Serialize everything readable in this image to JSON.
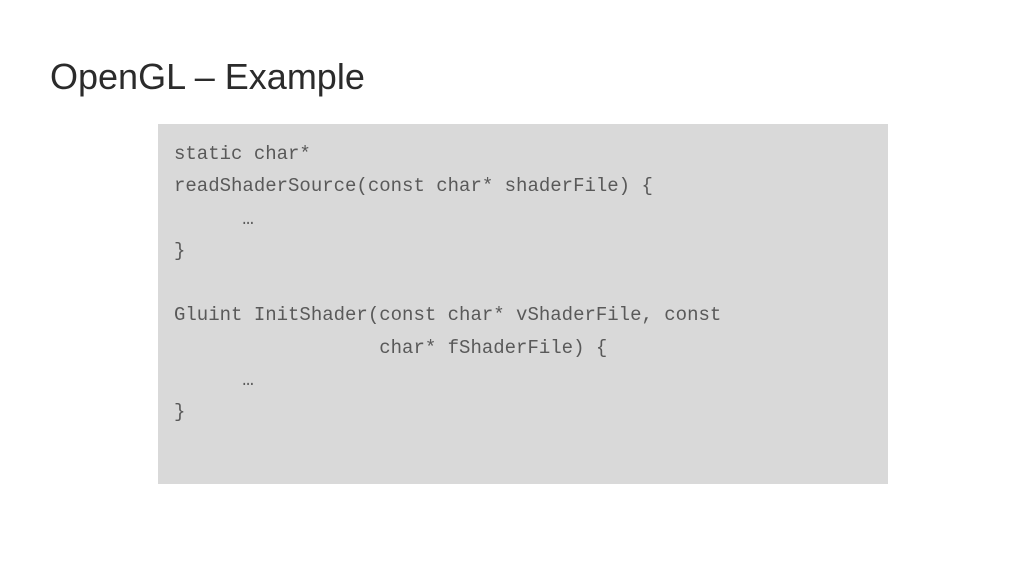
{
  "slide": {
    "title": "OpenGL – Example",
    "code": {
      "line1": "static char*",
      "line2": "readShaderSource(const char* shaderFile) {",
      "line3": "      …",
      "line4": "}",
      "line5": "",
      "line6": "Gluint InitShader(const char* vShaderFile, const",
      "line7": "                  char* fShaderFile) {",
      "line8": "      …",
      "line9": "}"
    }
  }
}
